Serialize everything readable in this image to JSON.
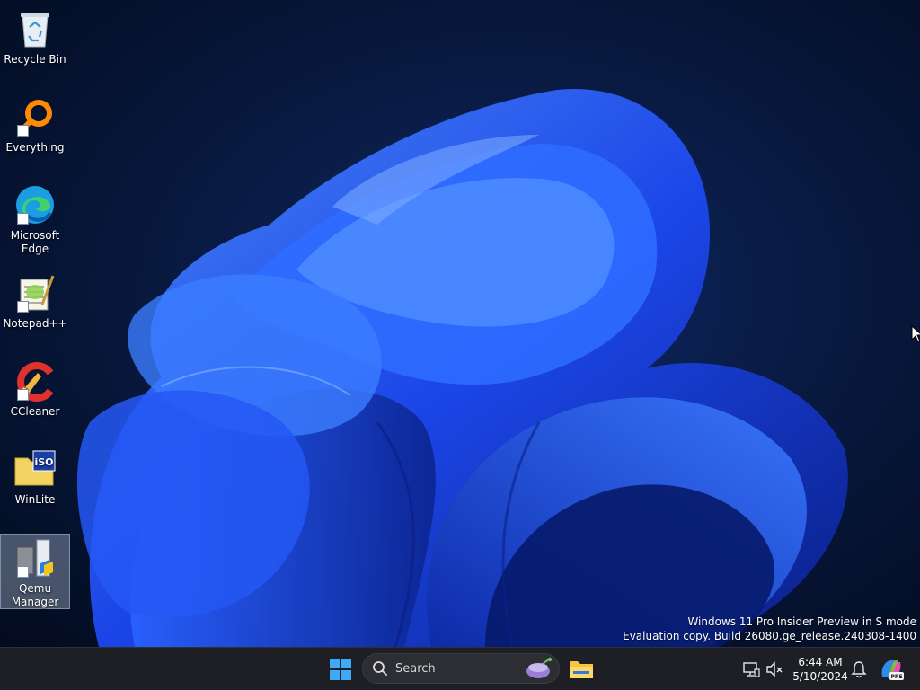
{
  "desktop": {
    "icons": [
      {
        "label": "Recycle Bin",
        "icon": "recycle-bin-icon"
      },
      {
        "label": "Everything",
        "icon": "magnifier-icon"
      },
      {
        "label": "Microsoft Edge",
        "icon": "edge-icon"
      },
      {
        "label": "Notepad++",
        "icon": "notepad-plus-plus-icon"
      },
      {
        "label": "CCleaner",
        "icon": "ccleaner-icon"
      },
      {
        "label": "WinLite",
        "icon": "iso-folder-icon"
      },
      {
        "label": "Qemu Manager",
        "icon": "qemu-manager-icon",
        "selected": true
      }
    ],
    "watermark": {
      "line1": "Windows 11 Pro Insider Preview in S mode",
      "line2": "Evaluation copy. Build 26080.ge_release.240308-1400"
    }
  },
  "taskbar": {
    "start_icon": "windows-logo-icon",
    "search": {
      "label": "Search",
      "highlight_icon": "search-highlight-icon"
    },
    "pinned": [
      {
        "name": "File Explorer",
        "icon": "folder-icon"
      }
    ],
    "tray": {
      "network_icon": "network-icon",
      "volume_icon": "volume-muted-icon",
      "time": "6:44 AM",
      "date": "5/10/2024",
      "notification_icon": "bell-icon",
      "copilot_icon": "copilot-icon",
      "copilot_badge": "PRE"
    }
  },
  "colors": {
    "wallpaper_bloom": "#1f4fff",
    "wallpaper_bg": "#061434",
    "taskbar_bg": "#1d1f24",
    "start_blue": "#3fa9f5"
  }
}
